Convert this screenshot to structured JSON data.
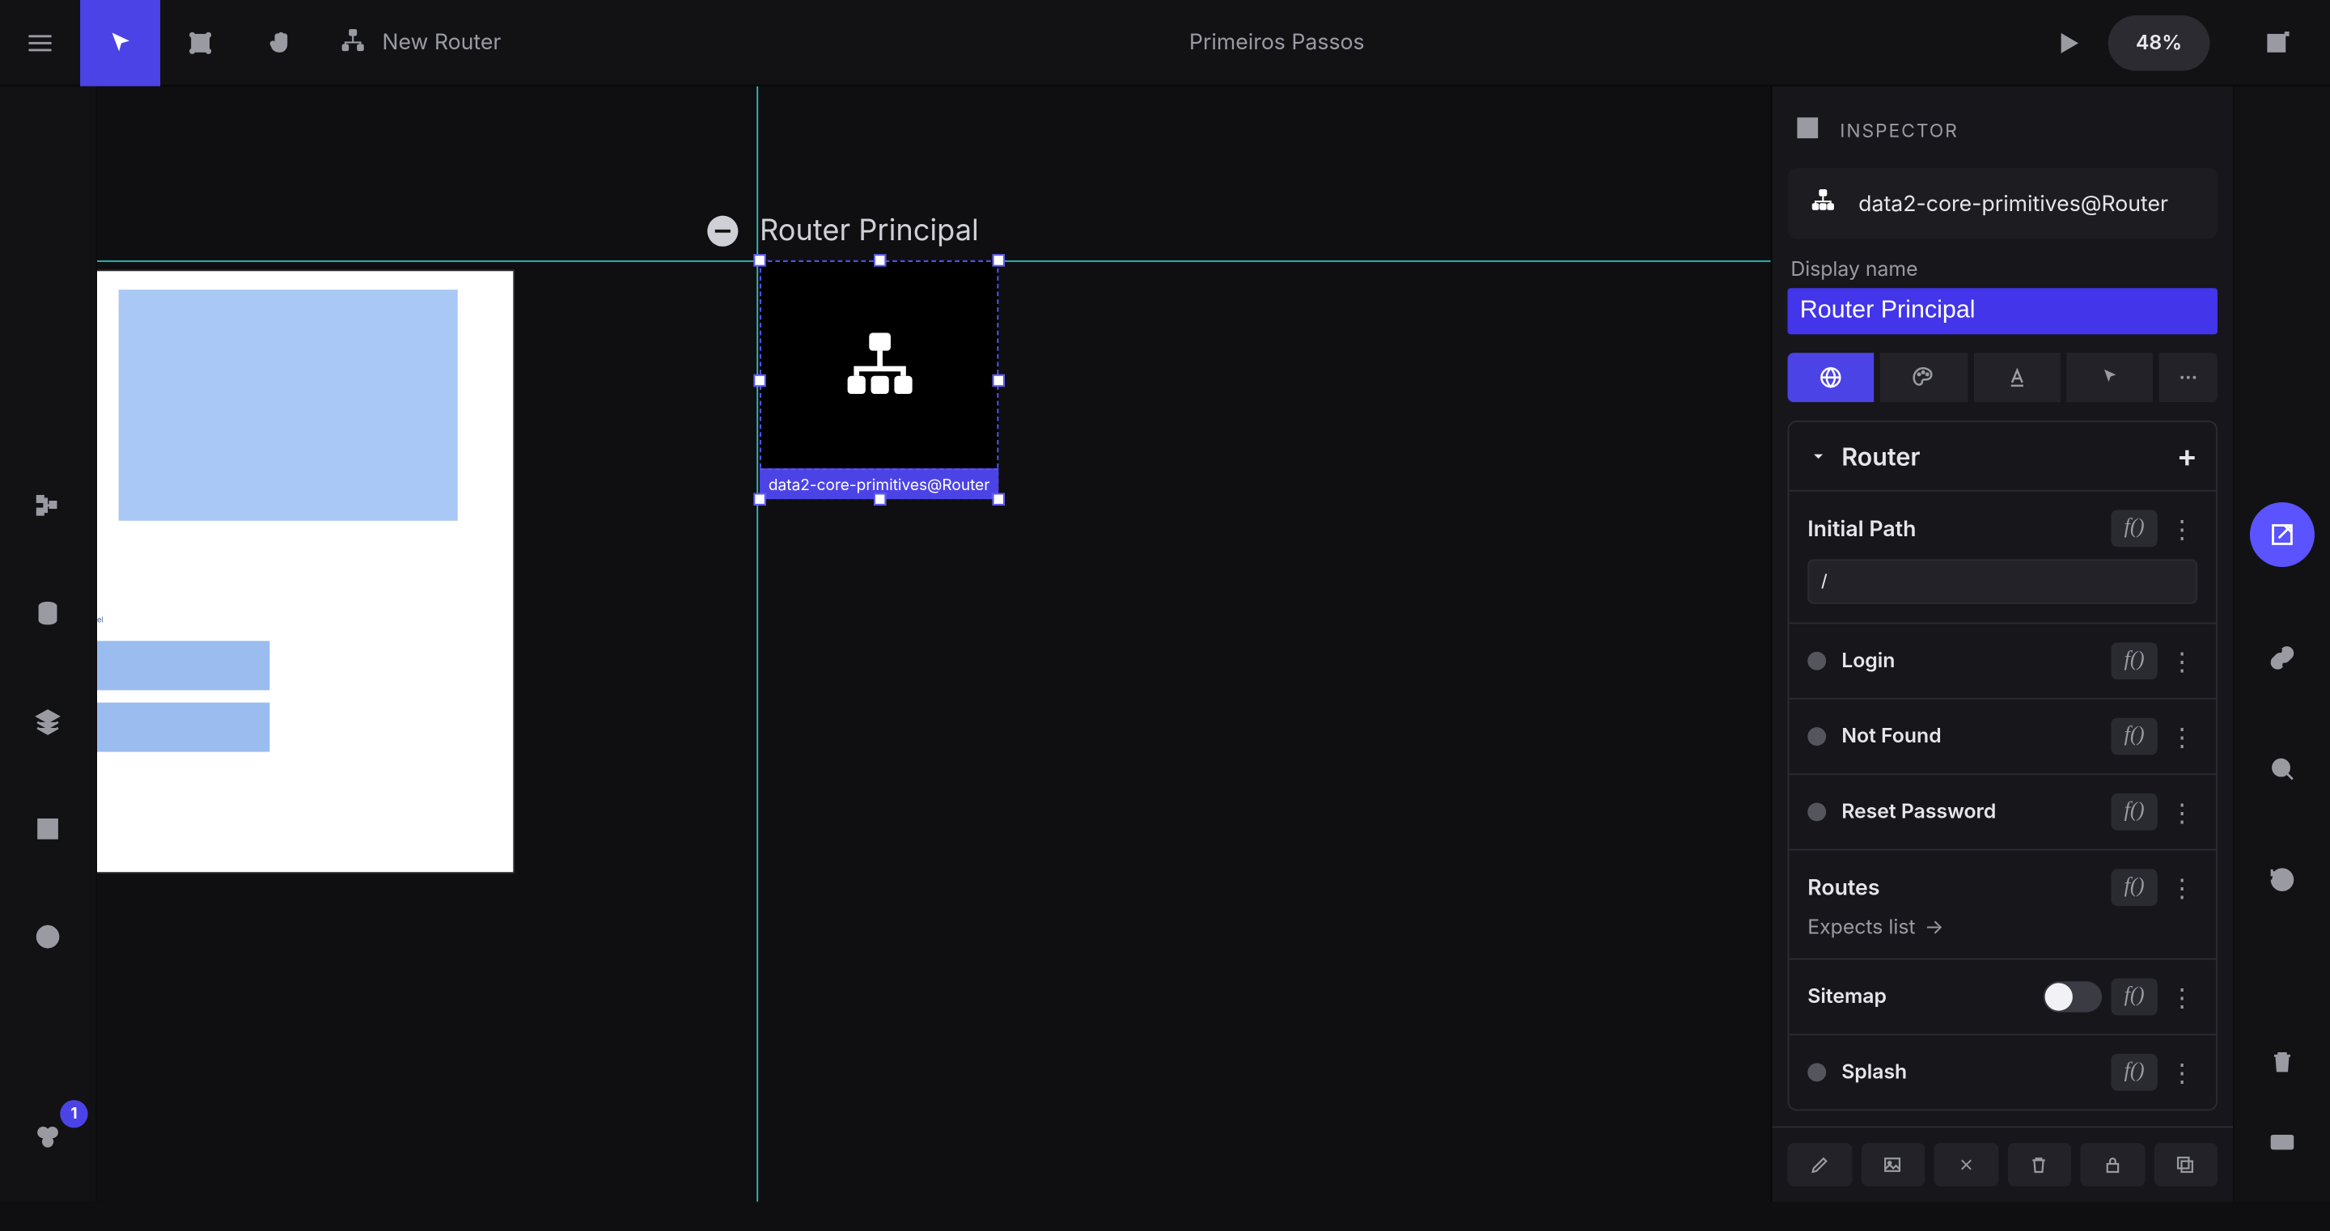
{
  "topbar": {
    "title": "Primeiros Passos",
    "new_menu_label": "New Router",
    "zoom": "48%"
  },
  "canvas": {
    "node_title": "Router Principal",
    "node_tag": "data2-core-primitives@Router",
    "preview_tiny_label": "el"
  },
  "left_rail": {
    "badge": "1"
  },
  "inspector": {
    "header": "INSPECTOR",
    "object_type": "data2-core-primitives@Router",
    "display_name_label": "Display name",
    "display_name_value": "Router Principal",
    "section": {
      "title": "Router",
      "initial_path_label": "Initial Path",
      "initial_path_value": "/",
      "rows": {
        "login": "Login",
        "not_found": "Not Found",
        "reset_password": "Reset Password",
        "routes": "Routes",
        "routes_hint": "Expects list",
        "sitemap": "Sitemap",
        "splash": "Splash"
      }
    }
  },
  "icons": {
    "fx": "f()"
  }
}
